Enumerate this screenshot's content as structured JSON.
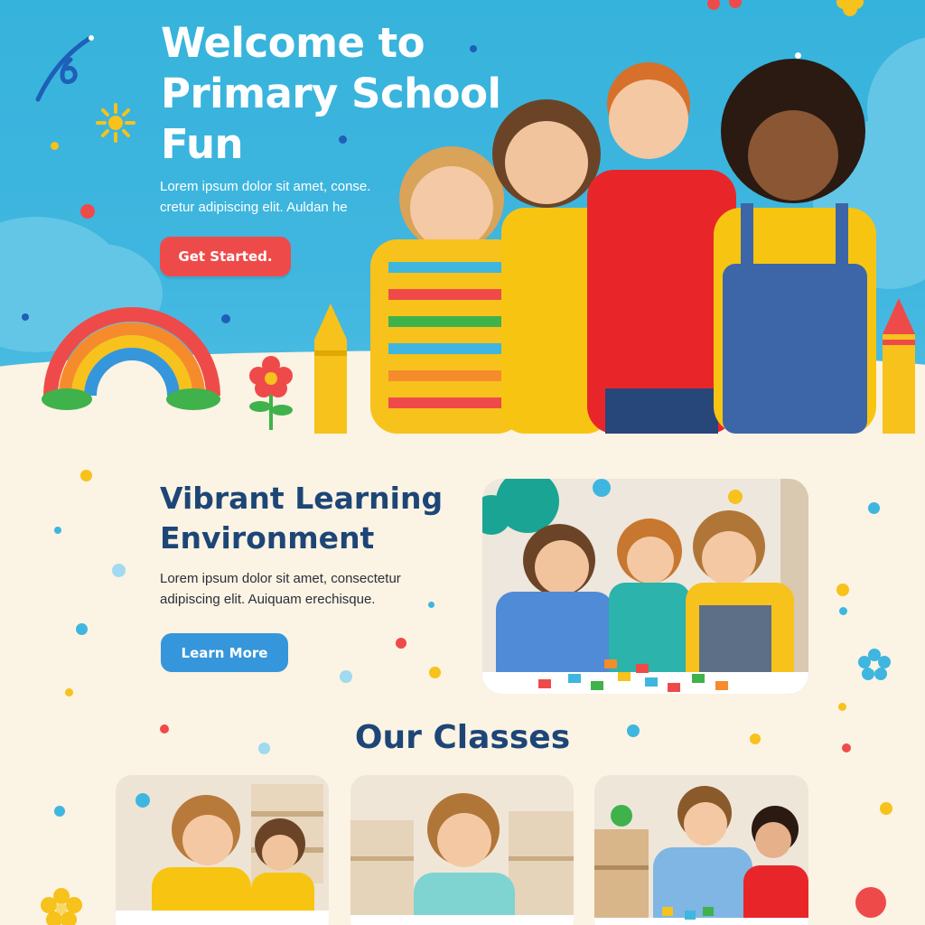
{
  "hero": {
    "title_line1": "Welcome to",
    "title_line2": "Primary School",
    "title_line3": "Fun",
    "description_line1": "Lorem ipsum dolor sit amet, conse.",
    "description_line2": "cretur adipiscing elit. Auldan he",
    "cta_label": "Get Started."
  },
  "environment": {
    "title_line1": "Vibrant Learning",
    "title_line2": "Environment",
    "description_line1": "Lorem ipsum dolor sit amet, consectetur",
    "description_line2": "adipiscing elit. Auiquam erechisque.",
    "cta_label": "Learn More"
  },
  "classes": {
    "title": "Our Classes"
  },
  "colors": {
    "hero_bg": "#3fb6df",
    "cream_bg": "#fbf3e3",
    "heading_navy": "#1d4677",
    "cta_red": "#ef4a4a",
    "cta_blue": "#3596db"
  }
}
